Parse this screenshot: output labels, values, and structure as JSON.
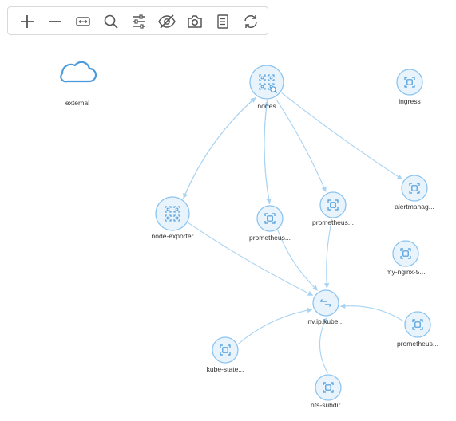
{
  "toolbar": {
    "buttons": [
      {
        "name": "zoom-in-button",
        "icon": "plus-icon"
      },
      {
        "name": "zoom-out-button",
        "icon": "minus-icon"
      },
      {
        "name": "fit-view-button",
        "icon": "fit-arrows-icon"
      },
      {
        "name": "search-button",
        "icon": "search-icon"
      },
      {
        "name": "filter-settings-button",
        "icon": "sliders-icon"
      },
      {
        "name": "toggle-visibility-button",
        "icon": "eye-off-icon"
      },
      {
        "name": "screenshot-button",
        "icon": "camera-icon"
      },
      {
        "name": "list-view-button",
        "icon": "list-icon"
      },
      {
        "name": "refresh-button",
        "icon": "refresh-icon"
      }
    ]
  },
  "colors": {
    "node_fill": "#e9f3fc",
    "node_stroke": "#8cc4ef",
    "icon": "#4a9bdc",
    "edge": "#a8d3f2",
    "toolbar_icon": "#555555"
  },
  "graph": {
    "nodes": [
      {
        "id": "external",
        "label": "external",
        "icon": "cloud-icon"
      },
      {
        "id": "nodes",
        "label": "nodes",
        "icon": "nodes-grid-icon"
      },
      {
        "id": "ingress",
        "label": "ingress",
        "icon": "pod-icon"
      },
      {
        "id": "alertmanager",
        "label": "alertmanag...",
        "icon": "pod-icon"
      },
      {
        "id": "node-exporter",
        "label": "node-exporter",
        "icon": "nodes-grid-icon"
      },
      {
        "id": "prometheus-1",
        "label": "prometheus...",
        "icon": "pod-icon"
      },
      {
        "id": "prometheus-2",
        "label": "prometheus...",
        "icon": "pod-icon"
      },
      {
        "id": "my-nginx",
        "label": "my-nginx-5...",
        "icon": "pod-icon"
      },
      {
        "id": "nv-ip-kube",
        "label": "nv.ip.kube...",
        "icon": "arrows-lr-icon"
      },
      {
        "id": "prometheus-3",
        "label": "prometheus...",
        "icon": "pod-icon"
      },
      {
        "id": "kube-state",
        "label": "kube-state...",
        "icon": "pod-icon"
      },
      {
        "id": "nfs-subdir",
        "label": "nfs-subdir...",
        "icon": "pod-icon"
      }
    ],
    "edges": [
      {
        "from": "node-exporter",
        "to": "nodes"
      },
      {
        "from": "nodes",
        "to": "node-exporter"
      },
      {
        "from": "nodes",
        "to": "prometheus-1"
      },
      {
        "from": "prometheus-1",
        "to": "nodes"
      },
      {
        "from": "nodes",
        "to": "prometheus-2"
      },
      {
        "from": "nodes",
        "to": "alertmanager"
      },
      {
        "from": "node-exporter",
        "to": "nv-ip-kube"
      },
      {
        "from": "prometheus-1",
        "to": "nv-ip-kube"
      },
      {
        "from": "prometheus-2",
        "to": "nv-ip-kube"
      },
      {
        "from": "prometheus-3",
        "to": "nv-ip-kube"
      },
      {
        "from": "kube-state",
        "to": "nv-ip-kube"
      },
      {
        "from": "nfs-subdir",
        "to": "nv-ip-kube"
      }
    ]
  }
}
